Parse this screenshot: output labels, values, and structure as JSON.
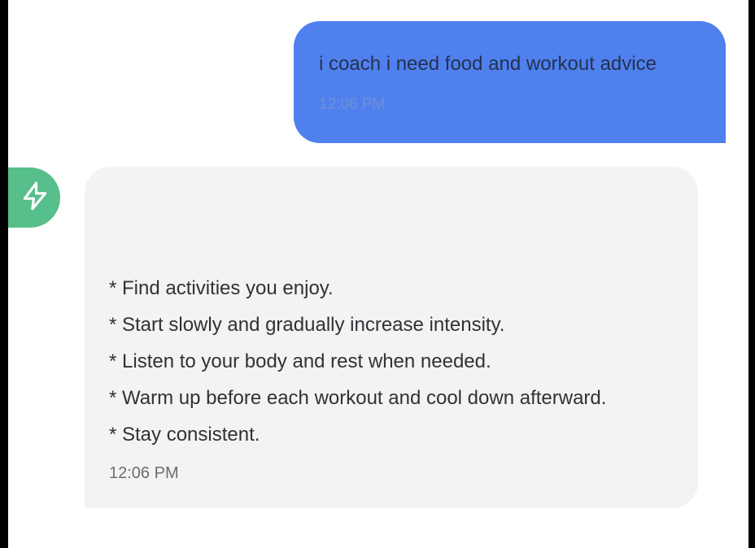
{
  "messages": {
    "user": {
      "text": "i coach i need food and workout advice",
      "time": "12:06 PM"
    },
    "assistant": {
      "avatar_icon": "lightning-bolt-icon",
      "lines": [
        "* Find activities you enjoy.",
        "* Start slowly and gradually increase intensity.",
        "* Listen to your body and rest when needed.",
        "* Warm up before each workout and cool down afterward.",
        "* Stay consistent."
      ],
      "time": "12:06 PM"
    }
  },
  "colors": {
    "user_bubble": "#4f80ee",
    "assistant_bubble": "#f3f3f2",
    "avatar": "#56bf8b"
  }
}
